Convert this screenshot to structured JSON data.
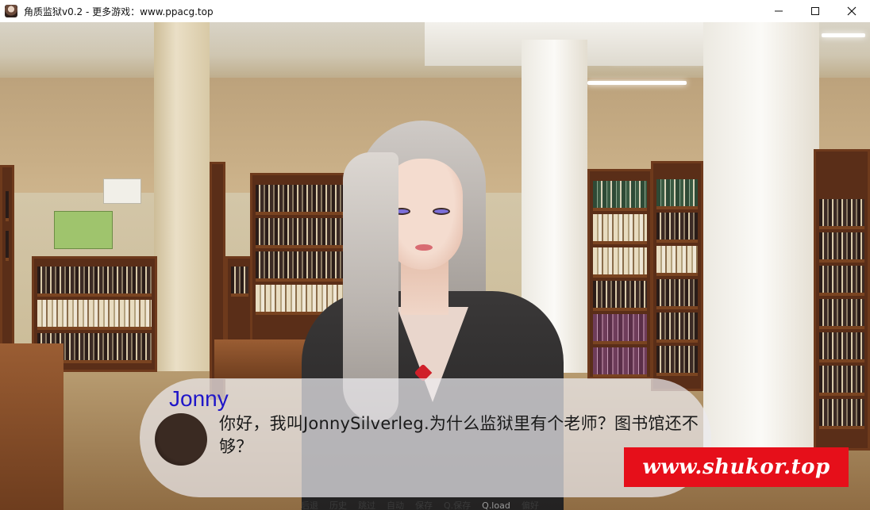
{
  "window": {
    "title": "角质监狱v0.2 - 更多游戏：www.ppacg.top",
    "controls": {
      "minimize": "—",
      "maximize": "☐",
      "close": "✕"
    }
  },
  "dialogue": {
    "speaker": "Jonny",
    "text": "你好，我叫JonnySilverleg.为什么监狱里有个老师？图书馆还不够？"
  },
  "watermark": "www.shukor.top",
  "quick_menu": [
    {
      "label": "后退",
      "enabled": true
    },
    {
      "label": "历史",
      "enabled": true
    },
    {
      "label": "跳过",
      "enabled": true
    },
    {
      "label": "自动",
      "enabled": true
    },
    {
      "label": "保存",
      "enabled": true
    },
    {
      "label": "Q.保存",
      "enabled": true
    },
    {
      "label": "Q.load",
      "enabled": false
    },
    {
      "label": "偏好",
      "enabled": true
    }
  ],
  "colors": {
    "speaker_name": "#1f16c9",
    "watermark_bg": "#e60f1a"
  }
}
